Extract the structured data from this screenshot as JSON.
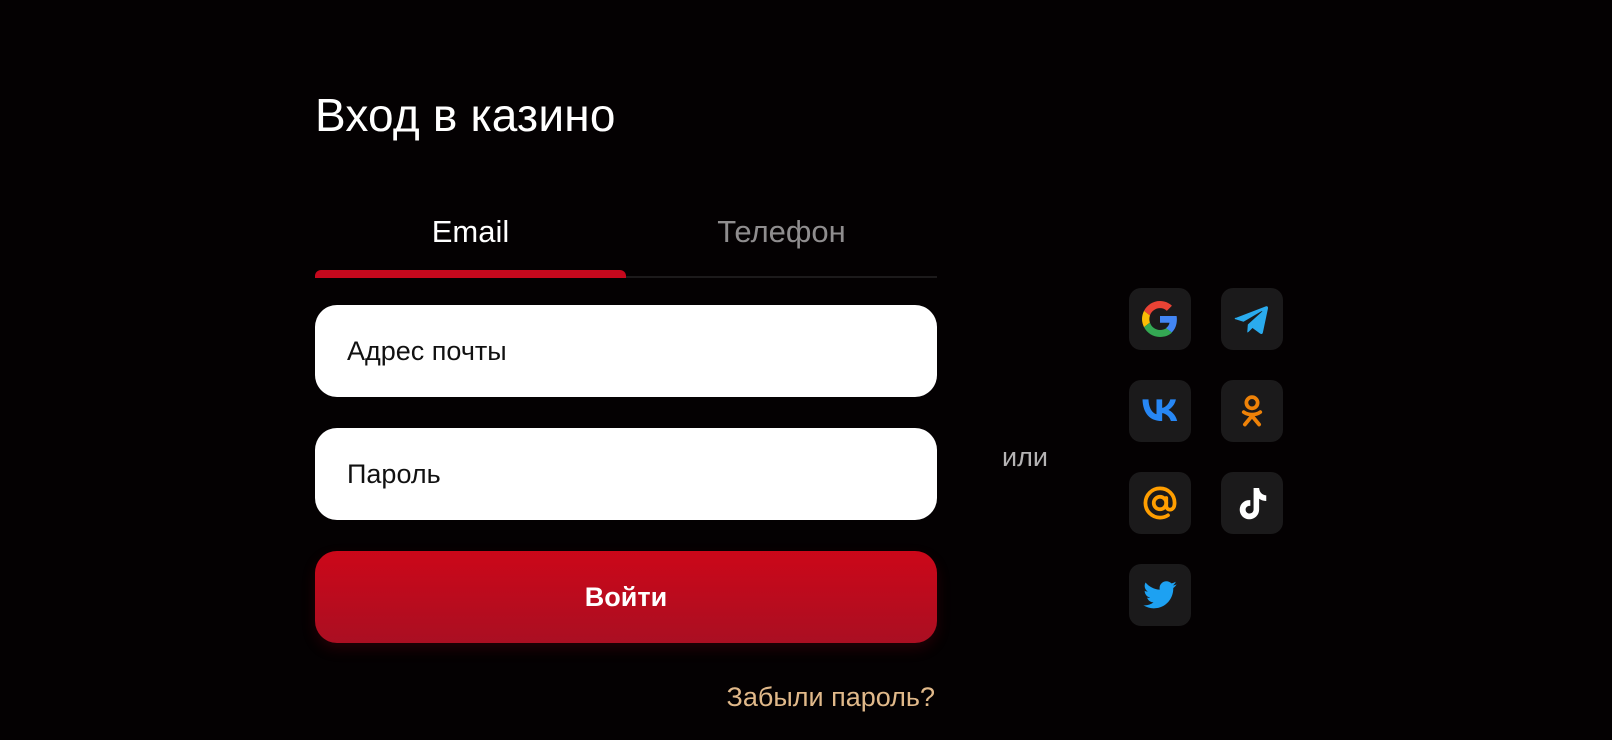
{
  "title": "Вход в казино",
  "tabs": [
    {
      "label": "Email",
      "active": true
    },
    {
      "label": "Телефон",
      "active": false
    }
  ],
  "form": {
    "email_placeholder": "Адрес почты",
    "email_value": "",
    "password_placeholder": "Пароль",
    "password_value": "",
    "submit_label": "Войти",
    "forgot_label": "Забыли пароль?"
  },
  "divider_label": "или",
  "social": [
    {
      "name": "google-icon"
    },
    {
      "name": "telegram-icon"
    },
    {
      "name": "vk-icon"
    },
    {
      "name": "odnoklassniki-icon"
    },
    {
      "name": "mail-ru-icon"
    },
    {
      "name": "tiktok-icon"
    },
    {
      "name": "twitter-icon"
    }
  ],
  "colors": {
    "background": "#040102",
    "accent": "#c5081d",
    "link": "#e1b98a",
    "tab_inactive": "#8f8d8e"
  }
}
